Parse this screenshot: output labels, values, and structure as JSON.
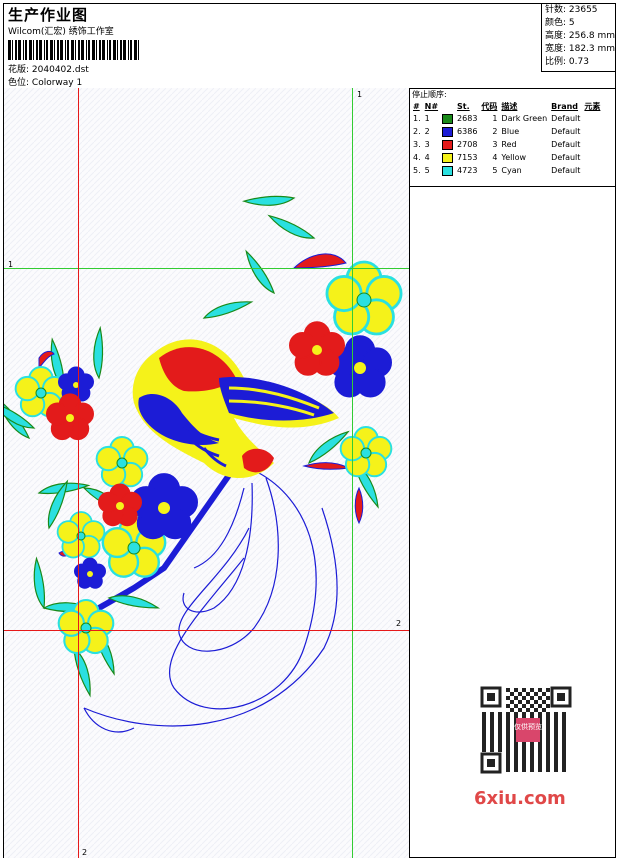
{
  "header": {
    "title": "生产作业图",
    "studio": "Wilcom(汇宏) 绣饰工作室",
    "design_label": "花版:",
    "design_value": "2040402.dst",
    "colorway_label": "色位:",
    "colorway_value": "Colorway 1"
  },
  "stats": {
    "stitches": "针数: 23655",
    "colors": "颜色: 5",
    "height": "高度: 256.8 mm",
    "width": "宽度: 182.3 mm",
    "scale": "比例: 0.73"
  },
  "sequence": {
    "title": "停止顺序:",
    "headers": [
      "#",
      "N#",
      "St.",
      "代码",
      "描述",
      "Brand",
      "元素"
    ],
    "rows": [
      {
        "num": "1.",
        "n": "1",
        "color": "#1a8a1a",
        "code": "2683",
        "st": "1",
        "desc": "Dark Green",
        "brand": "Default"
      },
      {
        "num": "2.",
        "n": "2",
        "color": "#1c1cd6",
        "code": "6386",
        "st": "2",
        "desc": "Blue",
        "brand": "Default"
      },
      {
        "num": "3.",
        "n": "3",
        "color": "#e31b1b",
        "code": "2708",
        "st": "3",
        "desc": "Red",
        "brand": "Default"
      },
      {
        "num": "4.",
        "n": "4",
        "color": "#f5f21a",
        "code": "7153",
        "st": "4",
        "desc": "Yellow",
        "brand": "Default"
      },
      {
        "num": "5.",
        "n": "5",
        "color": "#2ae0e0",
        "code": "4723",
        "st": "5",
        "desc": "Cyan",
        "brand": "Default"
      }
    ]
  },
  "guides": {
    "green_top_label": "1",
    "green_left_label": "1",
    "red_right_label": "2",
    "red_bottom_label": "2"
  },
  "watermark": {
    "stamp": "仅供预览",
    "brand": "6xiu.com"
  }
}
